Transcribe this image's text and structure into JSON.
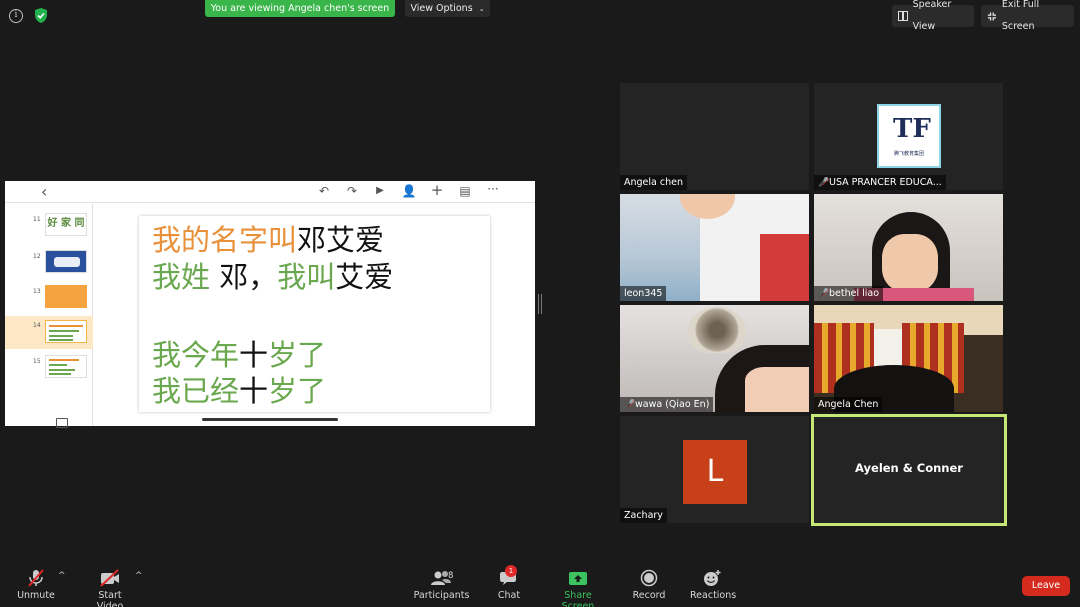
{
  "top_bar": {
    "banner": "You are viewing Angela chen's screen",
    "view_options": "View Options",
    "speaker_view": "Speaker View",
    "exit_full_screen": "Exit Full Screen"
  },
  "shared_screen": {
    "thumbnails": [
      {
        "num": "11",
        "text": "好 家 同"
      },
      {
        "num": "12",
        "text": ""
      },
      {
        "num": "13",
        "text": ""
      },
      {
        "num": "14",
        "text": ""
      },
      {
        "num": "15",
        "text": ""
      }
    ],
    "slide": {
      "line1_orange": "我的名字叫",
      "line1_black": "邓艾爱",
      "line2_green_a": "我姓",
      "line2_black_a": " 邓，",
      "line2_green_b": "我叫",
      "line2_black_b": "艾爱",
      "line3_green_a": "我今年",
      "line3_black": "十",
      "line3_green_b": "岁了",
      "line4_green_a": "我已经",
      "line4_black": "十",
      "line4_green_b": "岁了"
    }
  },
  "gallery": {
    "participants": [
      {
        "name": "Angela chen",
        "muted": false
      },
      {
        "name": "USA PRANCER EDUCA...",
        "muted": true
      },
      {
        "name": "leon345",
        "muted": false
      },
      {
        "name": "bethel liao",
        "muted": true
      },
      {
        "name": "wawa (Qiao En)",
        "muted": true
      },
      {
        "name": "Angela Chen",
        "muted": false
      },
      {
        "name": "Zachary",
        "muted": false,
        "avatar_letter": "L"
      },
      {
        "name": "Ayelen & Conner",
        "active_speaker": true
      }
    ],
    "logo_text": "腾飞教育集团"
  },
  "toolbar": {
    "unmute": "Unmute",
    "start_video": "Start Video",
    "participants": "Participants",
    "participants_count": "8",
    "chat": "Chat",
    "chat_badge": "1",
    "share_screen": "Share Screen",
    "record": "Record",
    "reactions": "Reactions",
    "leave": "Leave"
  },
  "colors": {
    "banner_green": "#39b54a",
    "leave_red": "#d52b1e",
    "active_border": "#c5e876",
    "share_green": "#3cc35f"
  }
}
